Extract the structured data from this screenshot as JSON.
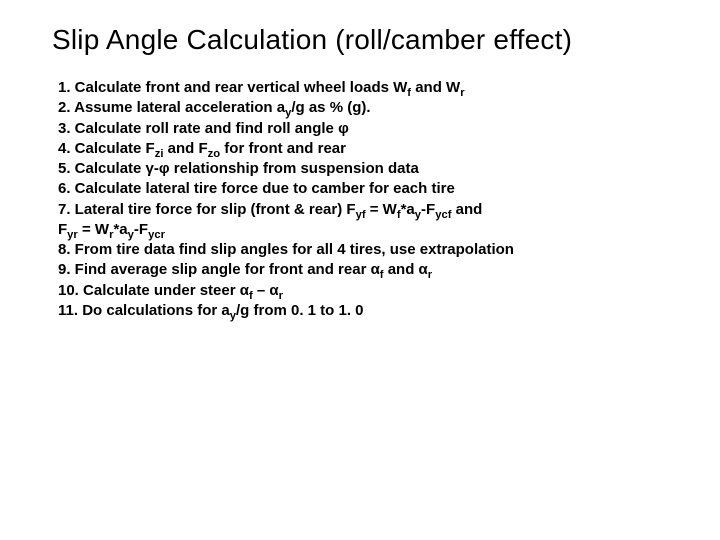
{
  "title": "Slip Angle Calculation (roll/camber effect)",
  "lines": {
    "l1a": "1. Calculate front and rear vertical wheel loads W",
    "l1b": " and W",
    "l2a": "2. Assume lateral acceleration a",
    "l2b": "/g as % (g).",
    "l3": "3. Calculate roll rate and find roll angle φ",
    "l4a": "4. Calculate F",
    "l4b": " and F",
    "l4c": " for front and rear",
    "l5": "5. Calculate γ-φ relationship from suspension data",
    "l6": "6. Calculate lateral tire force due to camber for each tire",
    "l7a": "7. Lateral tire force for slip (front & rear) F",
    "l7b": " = W",
    "l7c": "*a",
    "l7d": "-F",
    "l7e": " and",
    "l7fa": "F",
    "l7fb": " = W",
    "l7fc": "*a",
    "l7fd": "-F",
    "l8": "8. From tire data find slip angles for all 4 tires, use extrapolation",
    "l9a": "9. Find average slip angle for front and rear α",
    "l9b": " and α",
    "l10a": "10. Calculate under steer α",
    "l10b": " – α",
    "l11a": "11. Do calculations for a",
    "l11b": "/g from 0. 1 to 1. 0"
  },
  "sub": {
    "f": "f",
    "r": "r",
    "y": "y",
    "zi": "zi",
    "zo": "zo",
    "yf": "yf",
    "ycf": "ycf",
    "yr": "yr",
    "ycr": "ycr"
  }
}
